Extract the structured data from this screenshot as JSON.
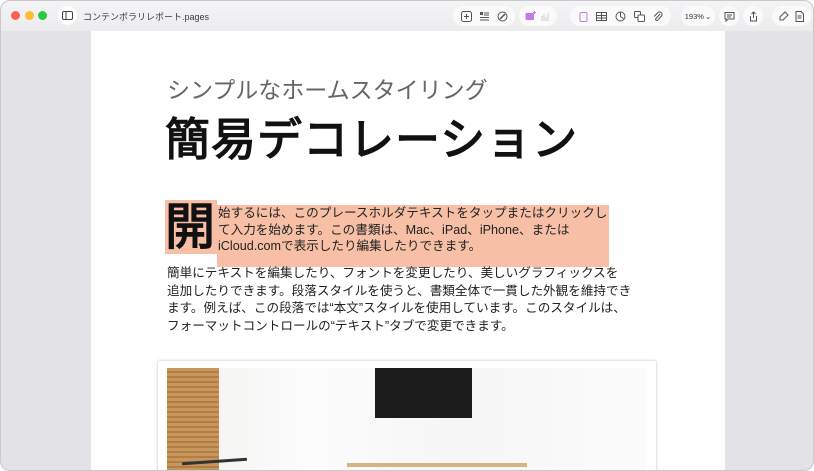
{
  "window": {
    "filename": "コンテンポラリレポート.pages"
  },
  "toolbar": {
    "zoom": "193%",
    "icons": [
      "add-page-icon",
      "text-box-list-icon",
      "format-brush-icon",
      "media-icon",
      "chart-icon",
      "textbox-icon",
      "table-icon",
      "shape-chart-icon",
      "shapes-icon",
      "attachment-icon",
      "comment-icon",
      "share-icon",
      "format-icon",
      "document-icon"
    ]
  },
  "document": {
    "subtitle": "シンプルなホームスタイリング",
    "title": "簡易デコレーション",
    "drop_cap": "開",
    "highlighted_lines": [
      "始するには、このプレースホルダテキストをタップまたはクリックし",
      "て入力を始めます。この書類は、Mac、iPad、iPhone、または",
      "iCloud.comで表示したり編集したりできます。"
    ],
    "body_lines": [
      "簡単にテキストを編集したり、フォントを変更したり、美しいグラフィックスを",
      "追加したりできます。段落スタイルを使うと、書類全体で一貫した外観を維持でき",
      "ます。例えば、この段落では“本文”スタイルを使用しています。このスタイルは、",
      "フォーマットコントロールの“テキスト”タブで変更できます。"
    ],
    "highlight_color": "#f7bfa6"
  }
}
